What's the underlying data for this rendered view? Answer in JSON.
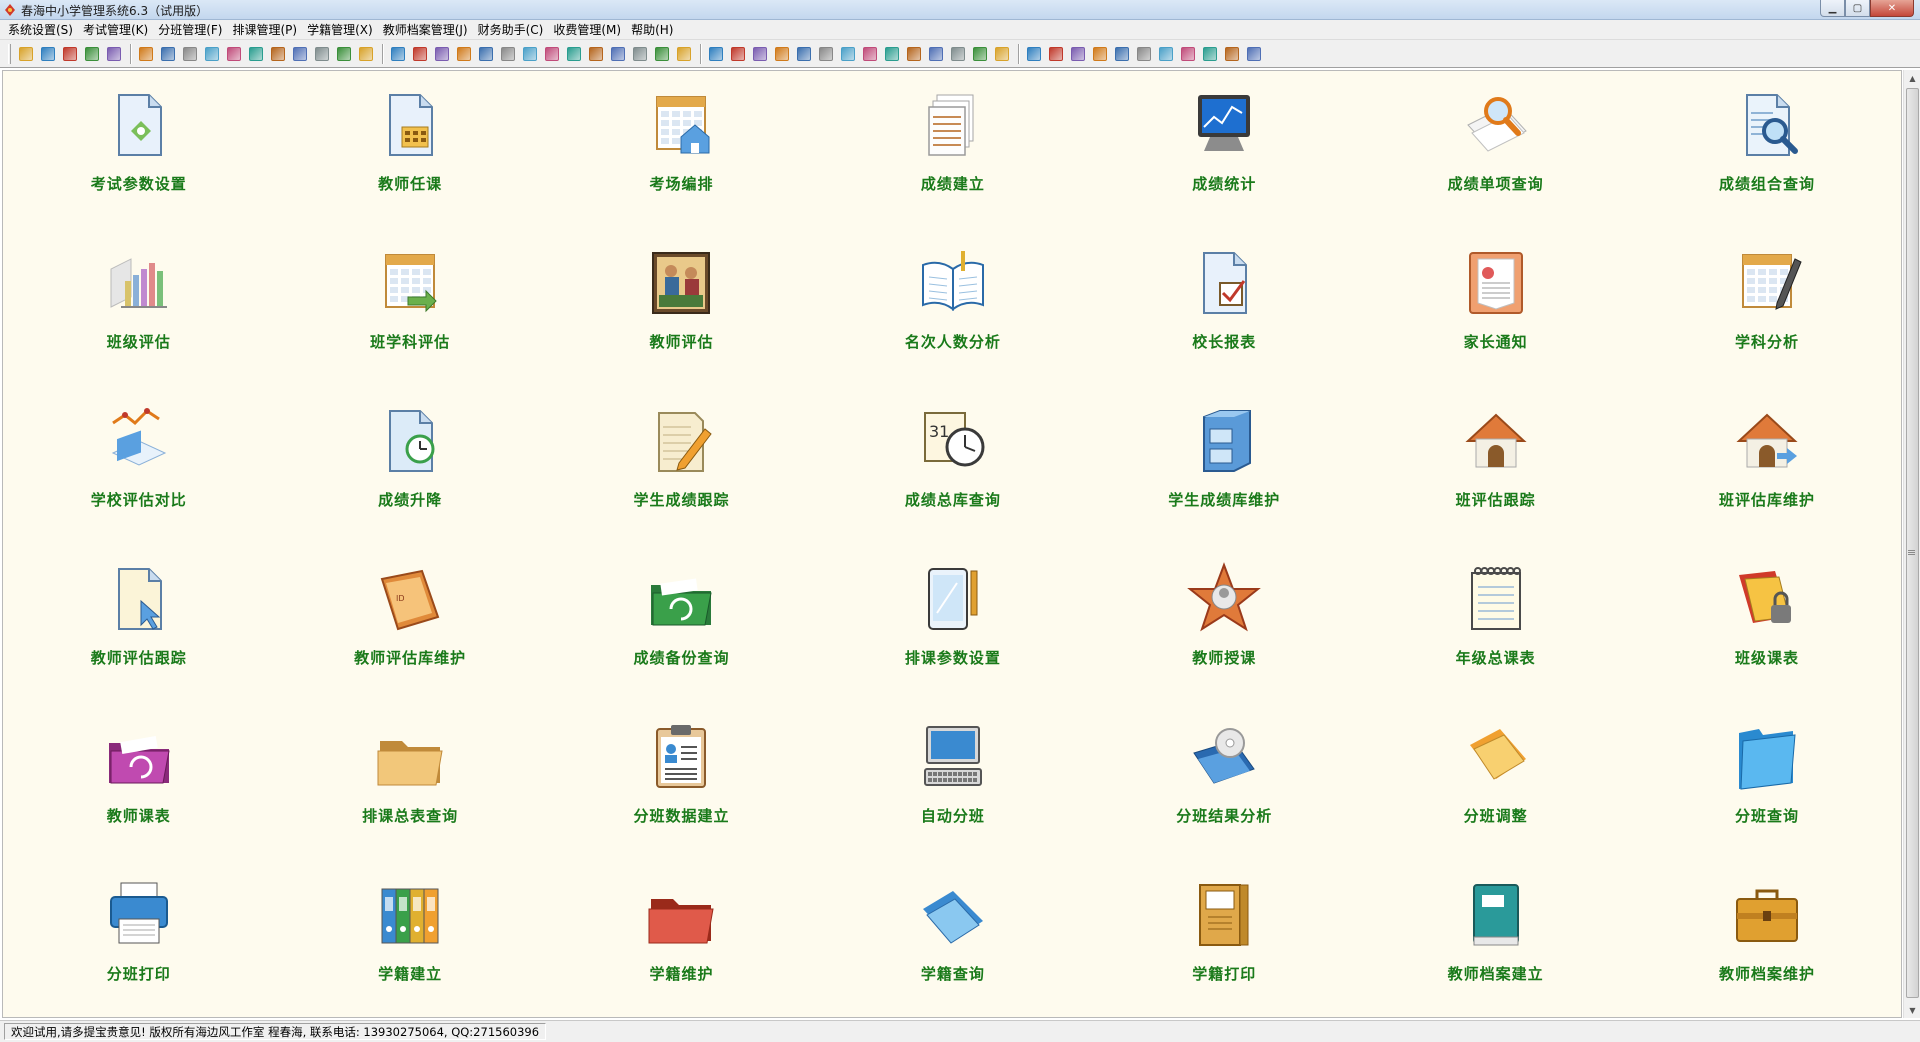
{
  "window": {
    "title": "春海中小学管理系统6.3（试用版）"
  },
  "menu": [
    {
      "label": "系统设置(S)"
    },
    {
      "label": "考试管理(K)"
    },
    {
      "label": "分班管理(F)"
    },
    {
      "label": "排课管理(P)"
    },
    {
      "label": "学籍管理(X)"
    },
    {
      "label": "教师档案管理(J)"
    },
    {
      "label": "财务助手(C)"
    },
    {
      "label": "收费管理(M)"
    },
    {
      "label": "帮助(H)"
    }
  ],
  "toolbar_colors": [
    "#d8a22a",
    "#2f7fbf",
    "#c0392b",
    "#3a8f3a",
    "#7a5cb0",
    "#d07a1a",
    "#3b6fae",
    "#888888",
    "#4aa0c8",
    "#c04b7a",
    "#2a9d8f",
    "#b5651d",
    "#4f6fb5",
    "#7f8c8d",
    "#3a8f3a",
    "#d8a22a",
    "#2f7fbf",
    "#c0392b",
    "#7a5cb0",
    "#d07a1a",
    "#3b6fae",
    "#888888",
    "#4aa0c8",
    "#c04b7a",
    "#2a9d8f",
    "#b5651d",
    "#4f6fb5",
    "#7f8c8d",
    "#3a8f3a",
    "#d8a22a",
    "#2f7fbf",
    "#c0392b",
    "#7a5cb0",
    "#d07a1a",
    "#3b6fae",
    "#888888",
    "#4aa0c8",
    "#c04b7a",
    "#2a9d8f",
    "#b5651d",
    "#4f6fb5",
    "#7f8c8d",
    "#3a8f3a",
    "#d8a22a",
    "#2f7fbf",
    "#c0392b",
    "#7a5cb0",
    "#d07a1a",
    "#3b6fae",
    "#888888",
    "#4aa0c8",
    "#c04b7a",
    "#2a9d8f",
    "#b5651d",
    "#4f6fb5"
  ],
  "modules": [
    {
      "label": "考试参数设置",
      "icon": "doc-gear-icon"
    },
    {
      "label": "教师任课",
      "icon": "doc-calc-icon"
    },
    {
      "label": "考场编排",
      "icon": "calendar-house-icon"
    },
    {
      "label": "成绩建立",
      "icon": "stacked-papers-icon"
    },
    {
      "label": "成绩统计",
      "icon": "monitor-chart-icon"
    },
    {
      "label": "成绩单项查询",
      "icon": "magnifier-papers-icon"
    },
    {
      "label": "成绩组合查询",
      "icon": "doc-magnifier-icon"
    },
    {
      "label": "班级评估",
      "icon": "bar-chart-icon"
    },
    {
      "label": "班学科评估",
      "icon": "calendar-arrow-icon"
    },
    {
      "label": "教师评估",
      "icon": "meeting-photo-icon"
    },
    {
      "label": "名次人数分析",
      "icon": "open-book-icon"
    },
    {
      "label": "校长报表",
      "icon": "doc-check-icon"
    },
    {
      "label": "家长通知",
      "icon": "certificate-icon"
    },
    {
      "label": "学科分析",
      "icon": "calendar-pen-icon"
    },
    {
      "label": "学校评估对比",
      "icon": "line-chart-icon"
    },
    {
      "label": "成绩升降",
      "icon": "doc-clock-icon"
    },
    {
      "label": "学生成绩跟踪",
      "icon": "notepad-pencil-icon"
    },
    {
      "label": "成绩总库查询",
      "icon": "calendar-clock-icon"
    },
    {
      "label": "学生成绩库维护",
      "icon": "file-cabinet-icon"
    },
    {
      "label": "班评估跟踪",
      "icon": "house-icon"
    },
    {
      "label": "班评估库维护",
      "icon": "house-arrow-icon"
    },
    {
      "label": "教师评估跟踪",
      "icon": "doc-cursor-icon"
    },
    {
      "label": "教师评估库维护",
      "icon": "orange-folder-icon"
    },
    {
      "label": "成绩备份查询",
      "icon": "green-folder-icon"
    },
    {
      "label": "排课参数设置",
      "icon": "tablet-pen-icon"
    },
    {
      "label": "教师授课",
      "icon": "star-badge-icon"
    },
    {
      "label": "年级总课表",
      "icon": "spiral-notepad-icon"
    },
    {
      "label": "班级课表",
      "icon": "folder-lock-icon"
    },
    {
      "label": "教师课表",
      "icon": "purple-folder-icon"
    },
    {
      "label": "排课总表查询",
      "icon": "open-folder-icon"
    },
    {
      "label": "分班数据建立",
      "icon": "clipboard-id-icon"
    },
    {
      "label": "自动分班",
      "icon": "computer-icon"
    },
    {
      "label": "分班结果分析",
      "icon": "disc-folder-icon"
    },
    {
      "label": "分班调整",
      "icon": "yellow-folder-icon"
    },
    {
      "label": "分班查询",
      "icon": "blue-folder-icon"
    },
    {
      "label": "分班打印",
      "icon": "printer-icon"
    },
    {
      "label": "学籍建立",
      "icon": "binders-icon"
    },
    {
      "label": "学籍维护",
      "icon": "red-folder-icon"
    },
    {
      "label": "学籍查询",
      "icon": "light-blue-folder-icon"
    },
    {
      "label": "学籍打印",
      "icon": "file-folder-icon"
    },
    {
      "label": "教师档案建立",
      "icon": "teal-book-icon"
    },
    {
      "label": "教师档案维护",
      "icon": "briefcase-icon"
    }
  ],
  "status": {
    "text": "欢迎试用,请多提宝贵意见!  版权所有海边风工作室 程春海,  联系电话: 13930275064, QQ:271560396"
  }
}
